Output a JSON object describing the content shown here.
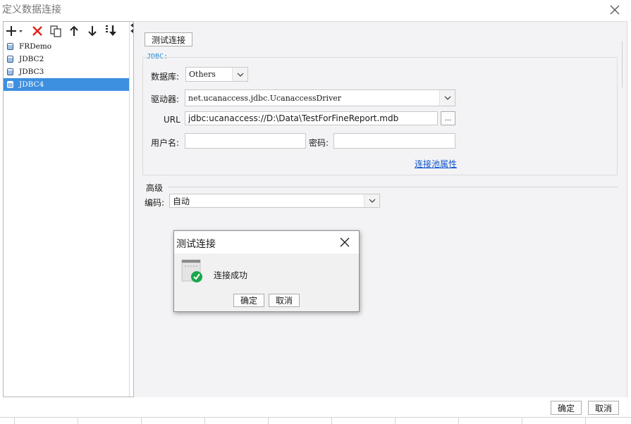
{
  "window": {
    "title": "定义数据连接"
  },
  "toolbar": {
    "icons": [
      "plus-icon",
      "dropdown-caret-icon",
      "delete-icon",
      "copy-icon",
      "arrow-up-icon",
      "arrow-down-icon",
      "move-bottom-icon"
    ]
  },
  "connections": [
    {
      "label": "FRDemo",
      "selected": false
    },
    {
      "label": "JDBC2",
      "selected": false
    },
    {
      "label": "JDBC3",
      "selected": false
    },
    {
      "label": "JDBC4",
      "selected": true
    }
  ],
  "main": {
    "test_button": "测试连接",
    "jdbc_group": "JDBC:",
    "database_label": "数据库:",
    "database_value": "Others",
    "driver_label": "驱动器:",
    "driver_value": "net.ucanaccess.jdbc.UcanaccessDriver",
    "url_label": "URL",
    "url_value": "jdbc:ucanaccess://D:\\Data\\TestForFineReport.mdb",
    "browse_button": "...",
    "username_label": "用户名:",
    "username_value": "",
    "password_label": "密码:",
    "password_value": "",
    "pool_link": "连接池属性",
    "advanced_label": "高级",
    "encoding_label": "编码:",
    "encoding_value": "自动"
  },
  "dialog": {
    "title": "测试连接",
    "message": "连接成功",
    "ok_button": "确定",
    "cancel_button": "取消"
  },
  "footer": {
    "ok_button": "确定",
    "cancel_button": "取消"
  },
  "colors": {
    "selection": "#3d8fe0",
    "link": "#1155cc",
    "group_label": "#1e8ad8",
    "success": "#19a64a",
    "delete": "#e0201c"
  }
}
